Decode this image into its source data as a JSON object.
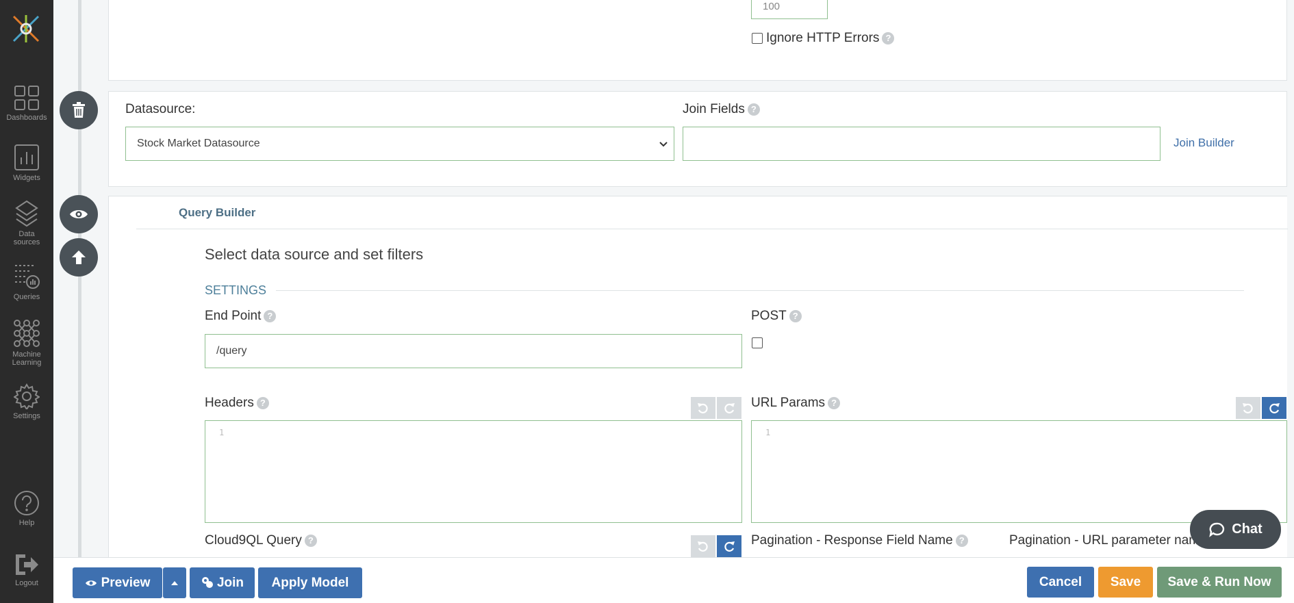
{
  "sidebar": {
    "items": [
      {
        "label": "Dashboards",
        "icon": "grid-icon"
      },
      {
        "label": "Widgets",
        "icon": "bar-chart-icon"
      },
      {
        "label": "Data sources",
        "icon": "layers-icon"
      },
      {
        "label": "Queries",
        "icon": "query-icon"
      },
      {
        "label": "Machine Learning",
        "icon": "network-icon"
      },
      {
        "label": "Settings",
        "icon": "gear-icon"
      },
      {
        "label": "Help",
        "icon": "help-icon"
      },
      {
        "label": "Logout",
        "icon": "logout-icon"
      }
    ]
  },
  "top_card": {
    "number_value": "100",
    "ignore_http_errors_label": "Ignore HTTP Errors"
  },
  "datasource": {
    "label": "Datasource:",
    "selected": "Stock Market Datasource",
    "join_fields_label": "Join Fields",
    "join_fields_value": "",
    "join_builder_link": "Join Builder"
  },
  "query_builder": {
    "tab_label": "Query Builder",
    "heading": "Select data source and set filters",
    "settings_label": "SETTINGS",
    "end_point_label": "End Point",
    "end_point_value": "/query",
    "post_label": "POST",
    "headers_label": "Headers",
    "headers_line_no": "1",
    "url_params_label": "URL Params",
    "url_params_line_no": "1",
    "cloud9ql_label": "Cloud9QL Query",
    "pagination_response_label": "Pagination - Response Field Name",
    "pagination_url_label": "Pagination - URL parameter name"
  },
  "bottom_bar": {
    "preview": "Preview",
    "join": "Join",
    "apply_model": "Apply Model",
    "cancel": "Cancel",
    "save": "Save",
    "save_run": "Save & Run Now"
  },
  "chat": {
    "label": "Chat"
  },
  "colors": {
    "sidebar_bg": "#2b2b2b",
    "primary_blue": "#3e70b0",
    "save_orange": "#ee9a30",
    "save_run_green": "#6f9a78",
    "input_border": "#8fbf8f"
  }
}
